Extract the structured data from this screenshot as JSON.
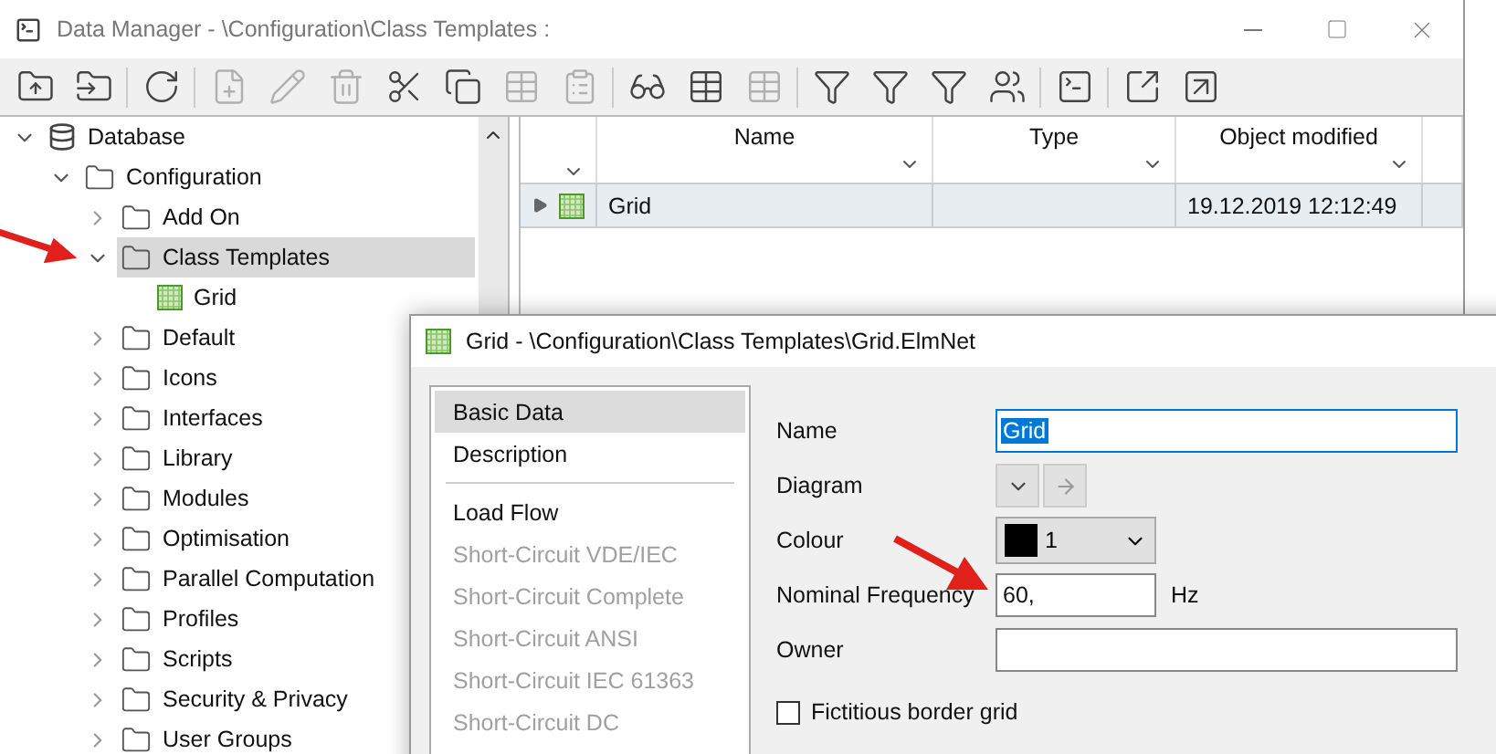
{
  "main_window": {
    "title": "Data Manager - \\Configuration\\Class Templates :",
    "toolbar": [
      {
        "kind": "folder-up",
        "disabled": false
      },
      {
        "kind": "folder-in",
        "disabled": false
      },
      {
        "kind": "separator"
      },
      {
        "kind": "refresh",
        "disabled": false
      },
      {
        "kind": "separator"
      },
      {
        "kind": "new",
        "disabled": true
      },
      {
        "kind": "edit",
        "disabled": true
      },
      {
        "kind": "delete",
        "disabled": true
      },
      {
        "kind": "cut",
        "disabled": false
      },
      {
        "kind": "copy",
        "disabled": false
      },
      {
        "kind": "table",
        "disabled": true
      },
      {
        "kind": "paste",
        "disabled": true
      },
      {
        "kind": "separator"
      },
      {
        "kind": "glasses",
        "disabled": false
      },
      {
        "kind": "table",
        "disabled": false
      },
      {
        "kind": "table",
        "disabled": true
      },
      {
        "kind": "separator"
      },
      {
        "kind": "filter",
        "disabled": false
      },
      {
        "kind": "filter",
        "disabled": false
      },
      {
        "kind": "filter",
        "disabled": false
      },
      {
        "kind": "users",
        "disabled": false
      },
      {
        "kind": "separator"
      },
      {
        "kind": "terminal",
        "disabled": false
      },
      {
        "kind": "separator"
      },
      {
        "kind": "import",
        "disabled": false
      },
      {
        "kind": "export",
        "disabled": false
      }
    ],
    "tree": [
      {
        "label": "Database",
        "kind": "database",
        "expanded": true,
        "selected": false,
        "children": [
          {
            "label": "Configuration",
            "kind": "folder",
            "expanded": true,
            "selected": false,
            "children": [
              {
                "label": "Add On",
                "kind": "folder",
                "expanded": false,
                "selected": false
              },
              {
                "label": "Class Templates",
                "kind": "folder",
                "expanded": true,
                "selected": true,
                "children": [
                  {
                    "label": "Grid",
                    "kind": "grid",
                    "selected": false
                  }
                ]
              },
              {
                "label": "Default",
                "kind": "folder",
                "expanded": false,
                "selected": false
              },
              {
                "label": "Icons",
                "kind": "folder",
                "expanded": false,
                "selected": false
              },
              {
                "label": "Interfaces",
                "kind": "folder",
                "expanded": false,
                "selected": false
              },
              {
                "label": "Library",
                "kind": "folder",
                "expanded": false,
                "selected": false
              },
              {
                "label": "Modules",
                "kind": "folder",
                "expanded": false,
                "selected": false
              },
              {
                "label": "Optimisation",
                "kind": "folder",
                "expanded": false,
                "selected": false
              },
              {
                "label": "Parallel Computation",
                "kind": "folder",
                "expanded": false,
                "selected": false
              },
              {
                "label": "Profiles",
                "kind": "folder",
                "expanded": false,
                "selected": false
              },
              {
                "label": "Scripts",
                "kind": "folder",
                "expanded": false,
                "selected": false
              },
              {
                "label": "Security & Privacy",
                "kind": "folder",
                "expanded": false,
                "selected": false
              },
              {
                "label": "User Groups",
                "kind": "folder",
                "expanded": false,
                "selected": false
              }
            ]
          }
        ]
      }
    ],
    "table": {
      "columns": [
        "Name",
        "Type",
        "Object modified"
      ],
      "rows": [
        {
          "name": "Grid",
          "modified": "19.12.2019 12:12:49",
          "selected": true
        }
      ]
    }
  },
  "dialog": {
    "title": "Grid - \\Configuration\\Class Templates\\Grid.ElmNet",
    "nav_groups": [
      [
        {
          "label": "Basic Data",
          "selected": true,
          "disabled": false
        },
        {
          "label": "Description",
          "selected": false,
          "disabled": false
        }
      ],
      [
        {
          "label": "Load Flow",
          "selected": false,
          "disabled": false
        },
        {
          "label": "Short-Circuit VDE/IEC",
          "selected": false,
          "disabled": true
        },
        {
          "label": "Short-Circuit Complete",
          "selected": false,
          "disabled": true
        },
        {
          "label": "Short-Circuit ANSI",
          "selected": false,
          "disabled": true
        },
        {
          "label": "Short-Circuit IEC 61363",
          "selected": false,
          "disabled": true
        },
        {
          "label": "Short-Circuit DC",
          "selected": false,
          "disabled": true
        }
      ]
    ],
    "fields": [
      {
        "kind": "text",
        "label": "Name",
        "value": "Grid",
        "focused": true
      },
      {
        "kind": "buttons",
        "label": "Diagram"
      },
      {
        "kind": "combo",
        "label": "Colour",
        "value": "1",
        "color": "#000000"
      },
      {
        "kind": "number",
        "label": "Nominal Frequency",
        "value": "60,",
        "unit": "Hz",
        "focused": false
      },
      {
        "kind": "text",
        "label": "Owner",
        "focused": false
      }
    ],
    "checkbox": {
      "label": "Fictitious border grid",
      "checked": false
    }
  }
}
